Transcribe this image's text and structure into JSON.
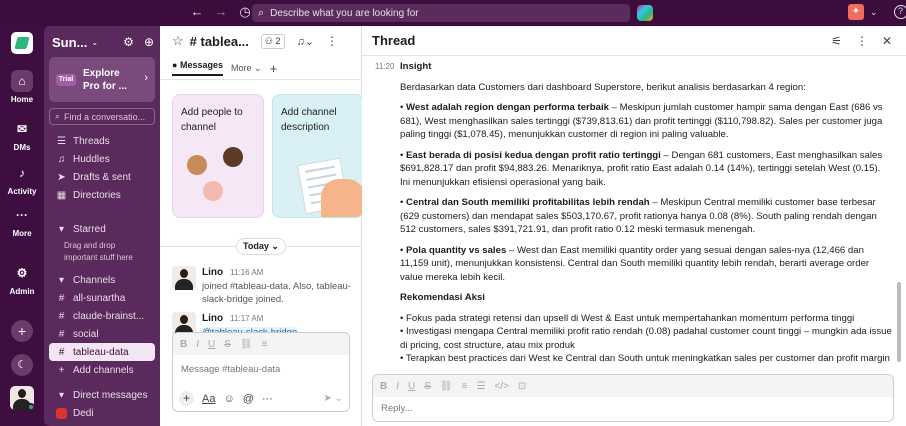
{
  "topbar": {
    "search_placeholder": "Describe what you are looking for"
  },
  "rail": {
    "items": [
      {
        "label": "Home",
        "icon": "home-icon"
      },
      {
        "label": "DMs",
        "icon": "dm-icon"
      },
      {
        "label": "Activity",
        "icon": "bell-icon"
      },
      {
        "label": "More",
        "icon": "more-icon"
      },
      {
        "label": "Admin",
        "icon": "gear-icon"
      }
    ]
  },
  "sidebar": {
    "workspace": "Sun...",
    "trial_badge": "Trial",
    "trial_text": "Explore Pro for ...",
    "find_placeholder": "Find a conversatio...",
    "nav": [
      "Threads",
      "Huddles",
      "Drafts & sent",
      "Directories"
    ],
    "starred_label": "Starred",
    "starred_hint": "Drag and drop important stuff here",
    "channels_label": "Channels",
    "channels": [
      "all-sunartha",
      "claude-brainst...",
      "social",
      "tableau-data"
    ],
    "add_channels": "Add channels",
    "dm_label": "Direct messages",
    "dm_first": "Dedi"
  },
  "channel": {
    "name": "# tablea...",
    "members": "2",
    "tabs": [
      "Messages",
      "More"
    ],
    "card1": "Add people to channel",
    "card2": "Add channel description",
    "today": "Today",
    "messages": [
      {
        "author": "Lino",
        "time": "11:16 AM",
        "text": "joined #tableau-data. Also, tableau-slack-bridge joined."
      },
      {
        "author": "Lino",
        "time": "11:17 AM",
        "text": "@tableau-slack-bridge"
      }
    ],
    "composer_placeholder": "Message #tableau-data"
  },
  "thread": {
    "title": "Thread",
    "time": "11:20",
    "heading": "Insight",
    "intro": "Berdasarkan data Customers dari dashboard Superstore, berikut analisis berdasarkan 4 region:",
    "points": [
      {
        "bold": "West adalah region dengan performa terbaik",
        "text": " – Meskipun jumlah customer hampir sama dengan East (686 vs 681), West menghasilkan sales tertinggi ($739,813.61) dan profit tertinggi ($110,798.82). Sales per customer juga paling tinggi ($1,078.45), menunjukkan customer di region ini paling valuable."
      },
      {
        "bold": "East berada di posisi kedua dengan profit ratio tertinggi",
        "text": " – Dengan 681 customers, East menghasilkan sales $691,828.17 dan profit $94,883.26. Menariknya, profit ratio East adalah 0.14 (14%), tertinggi setelah West (0.15). Ini menunjukkan efisiensi operasional yang baik."
      },
      {
        "bold": "Central dan South memiliki profitabilitas lebih rendah",
        "text": " – Meskipun Central memiliki customer base terbesar (629 customers) dan mendapat sales $503,170.67, profit rationya hanya 0.08 (8%). South paling rendah dengan 512 customers, sales $391,721.91, dan profit ratio 0.12 meski termasuk menengah."
      },
      {
        "bold": "Pola quantity vs sales",
        "text": " – West dan East memiliki quantity order yang sesuai dengan sales-nya (12,466 dan 11,159 unit), menunjukkan konsistensi. Central dan South memiliki quantity lebih rendah, berarti average order value mereka lebih kecil."
      }
    ],
    "rec_heading": "Rekomendasi Aksi",
    "recs": [
      "• Fokus pada strategi retensi dan upsell di West & East untuk mempertahankan momentum performa tinggi",
      "• Investigasi mengapa Central memiliki profit ratio rendah (0.08) padahal customer count tinggi – mungkin ada issue di pricing, cost structure, atau mix produk",
      "• Terapkan best practices dari West ke Central dan South untuk meningkatkan sales per customer dan profit margin"
    ],
    "reply_placeholder": "Reply..."
  }
}
